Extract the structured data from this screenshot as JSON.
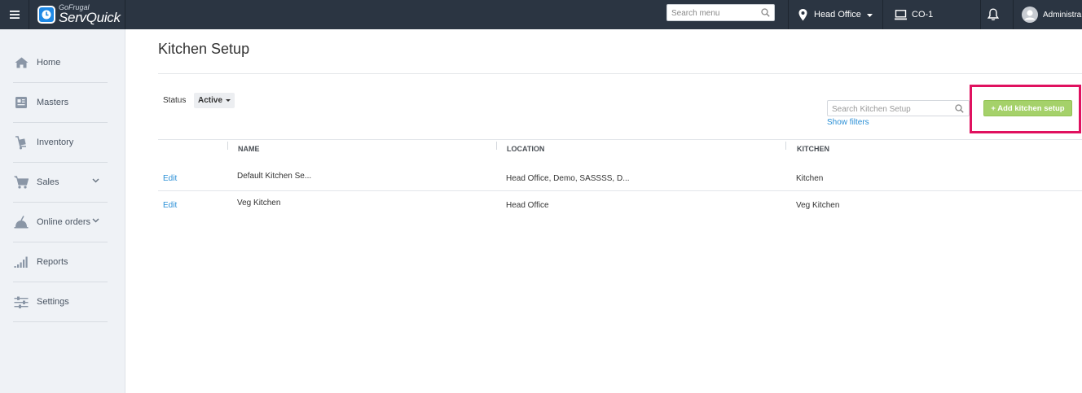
{
  "topbar": {
    "logo_small": "GoFrugal",
    "logo_main": "ServQuick",
    "search_placeholder": "Search menu",
    "location": "Head Office",
    "counter": "CO-1",
    "user": "Administra"
  },
  "sidebar": {
    "items": [
      {
        "label": "Home",
        "icon": "home-icon"
      },
      {
        "label": "Masters",
        "icon": "masters-icon"
      },
      {
        "label": "Inventory",
        "icon": "inventory-icon"
      },
      {
        "label": "Sales",
        "icon": "cart-icon",
        "has_chevron": true
      },
      {
        "label": "Online orders",
        "icon": "online-orders-icon",
        "has_chevron": true
      },
      {
        "label": "Reports",
        "icon": "reports-icon"
      },
      {
        "label": "Settings",
        "icon": "settings-icon"
      }
    ]
  },
  "main": {
    "title": "Kitchen Setup",
    "status_label": "Status",
    "status_value": "Active",
    "search_placeholder": "Search Kitchen Setup",
    "show_filters": "Show filters",
    "add_button": "+ Add kitchen setup",
    "table": {
      "headers": [
        "NAME",
        "LOCATION",
        "KITCHEN"
      ],
      "rows": [
        {
          "action": "Edit",
          "name": "Default Kitchen Se...",
          "location": "Head Office, Demo, SASSSS, D...",
          "kitchen": "Kitchen"
        },
        {
          "action": "Edit",
          "name": "Veg Kitchen",
          "location": "Head Office",
          "kitchen": "Veg Kitchen"
        }
      ]
    }
  },
  "colors": {
    "topbar_bg": "#2b3542",
    "sidebar_bg": "#eff2f6",
    "accent_link": "#2a8fd6",
    "add_button": "#a5d16a",
    "highlight": "#e0115f"
  }
}
